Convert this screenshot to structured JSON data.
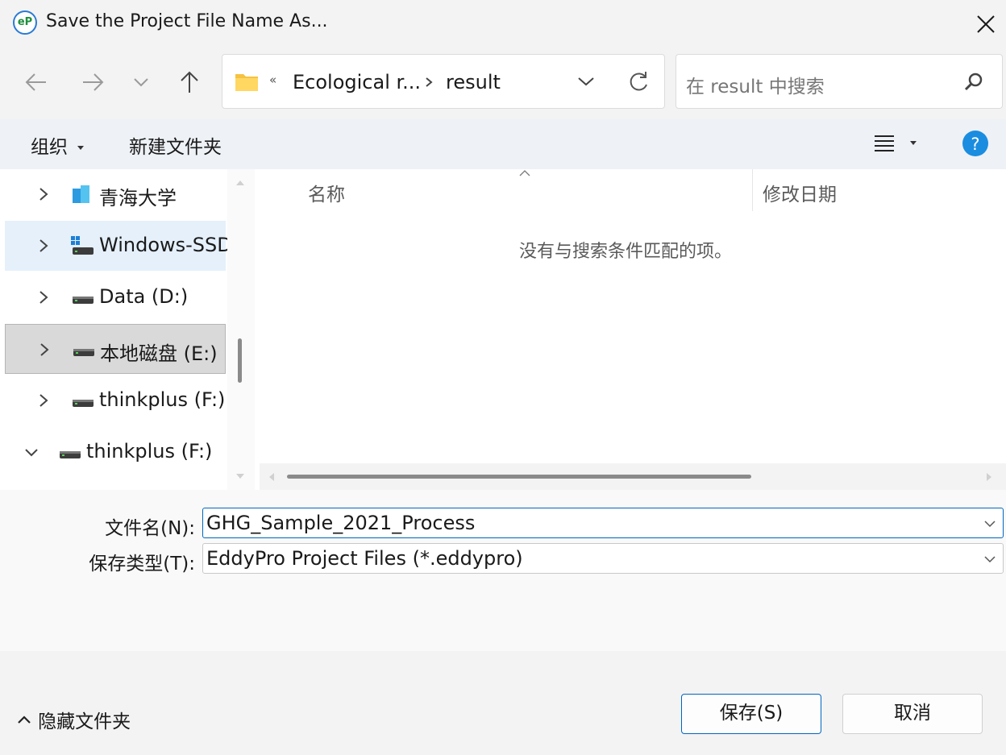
{
  "window": {
    "title": "Save the Project File Name As..."
  },
  "address": {
    "overflow": "«",
    "crumbs": [
      "Ecological r...",
      "result"
    ]
  },
  "search": {
    "placeholder": "在 result 中搜索"
  },
  "command_bar": {
    "organize": "组织",
    "new_folder": "新建文件夹"
  },
  "nav_tree": {
    "items": [
      {
        "label": "青海大学",
        "icon": "cloud-folder-icon",
        "expanded": false
      },
      {
        "label": "Windows-SSD",
        "icon": "system-drive-icon",
        "expanded": false,
        "selected": true
      },
      {
        "label": "Data (D:)",
        "icon": "drive-icon",
        "expanded": false
      },
      {
        "label": "本地磁盘 (E:)",
        "icon": "drive-icon",
        "expanded": false,
        "hovered": true
      },
      {
        "label": "thinkplus (F:)",
        "icon": "drive-icon",
        "expanded": false
      },
      {
        "label": "thinkplus (F:)",
        "icon": "drive-icon",
        "expanded": true
      }
    ]
  },
  "file_list": {
    "columns": [
      "名称",
      "修改日期"
    ],
    "empty_message": "没有与搜索条件匹配的项。"
  },
  "form": {
    "filename_label": "文件名(N):",
    "filename_value": "GHG_Sample_2021_Process",
    "type_label": "保存类型(T):",
    "type_value": "EddyPro Project Files (*.eddypro)"
  },
  "footer": {
    "hide_folders": "隐藏文件夹",
    "save": "保存(S)",
    "cancel": "取消"
  },
  "colors": {
    "accent": "#0067c0",
    "selected_bg": "#e5f0fb",
    "hover_bg": "#d9d9d9",
    "help_icon": "#1a8de0"
  }
}
